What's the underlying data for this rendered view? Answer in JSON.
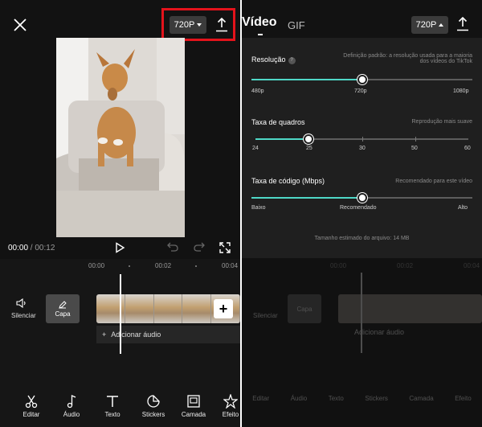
{
  "left": {
    "resolution_badge": "720P",
    "time_current": "00:00",
    "time_sep": " / ",
    "time_total": "00:12",
    "ruler": [
      "00:00",
      "00:02",
      "00:04"
    ],
    "mute_label": "Silenciar",
    "cover_label": "Capa",
    "add_audio_label": "Adicionar áudio",
    "toolbar": [
      {
        "label": "Editar",
        "icon": "scissors-icon"
      },
      {
        "label": "Áudio",
        "icon": "music-note-icon"
      },
      {
        "label": "Texto",
        "icon": "text-icon"
      },
      {
        "label": "Stickers",
        "icon": "sticker-icon"
      },
      {
        "label": "Camada",
        "icon": "overlay-icon"
      },
      {
        "label": "Efeito",
        "icon": "effects-icon"
      }
    ],
    "highlight_color": "#e4131b"
  },
  "right": {
    "tab_video": "Vídeo",
    "tab_gif": "GIF",
    "resolution_badge": "720P",
    "resolution": {
      "title": "Resolução",
      "note_line1": "Definição padrão: a resolução usada para a maioria",
      "note_line2": "dos vídeos do TikTok",
      "options": [
        "480p",
        "720p",
        "1080p"
      ],
      "selected": "720p",
      "position": 0.5
    },
    "frame_rate": {
      "title": "Taxa de quadros",
      "note": "Reprodução mais suave",
      "options": [
        "24",
        "25",
        "30",
        "50",
        "60"
      ],
      "selected": "25",
      "position": 0.25
    },
    "bitrate": {
      "title": "Taxa de código (Mbps)",
      "note": "Recomendado para este vídeo",
      "options": [
        "Baixo",
        "Recomendado",
        "Alto"
      ],
      "selected": "Recomendado",
      "position": 0.5
    },
    "file_size": "Tamanho estimado do arquivo: 14 MB",
    "accent_color": "#4fd8c7"
  }
}
